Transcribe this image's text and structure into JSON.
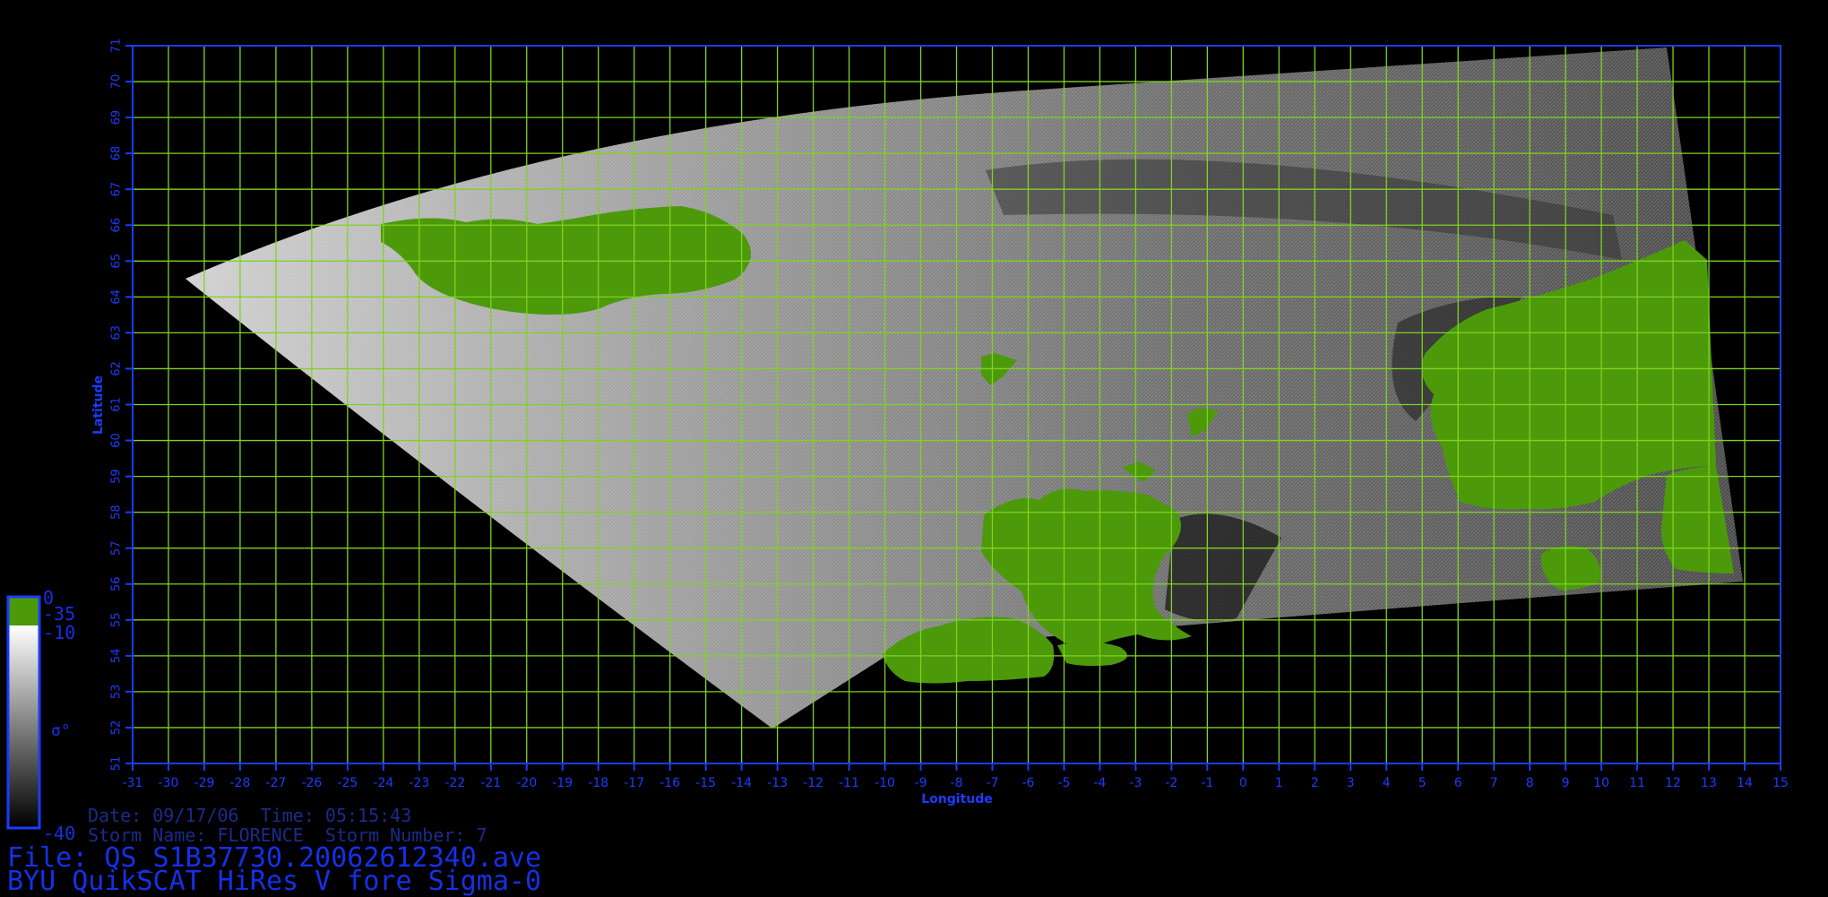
{
  "axes": {
    "x_label": "Longitude",
    "y_label": "Latitude",
    "x_ticks": [
      -31,
      -30,
      -29,
      -28,
      -27,
      -26,
      -25,
      -24,
      -23,
      -22,
      -21,
      -20,
      -19,
      -18,
      -17,
      -16,
      -15,
      -14,
      -13,
      -12,
      -11,
      -10,
      -9,
      -8,
      -7,
      -6,
      -5,
      -4,
      -3,
      -2,
      -1,
      0,
      1,
      2,
      3,
      4,
      5,
      6,
      7,
      8,
      9,
      10,
      11,
      12,
      13,
      14,
      15
    ],
    "y_ticks": [
      51,
      52,
      53,
      54,
      55,
      56,
      57,
      58,
      59,
      60,
      61,
      62,
      63,
      64,
      65,
      66,
      67,
      68,
      69,
      70,
      71
    ],
    "xlim": [
      -31,
      15
    ],
    "ylim": [
      51,
      71
    ],
    "grid": true,
    "grid_color": "#7ed321",
    "frame_color": "#1a3cff",
    "tick_color": "#1a3cff"
  },
  "colorbar": {
    "label": "σ°",
    "land_top": "0",
    "land_bottom": "-35",
    "scale_top": "-10",
    "scale_bottom": "-40",
    "land_color": "#4c9a0a",
    "high_color": "#ffffff",
    "low_color": "#000000"
  },
  "info": {
    "date_line": "Date: 09/17/06  Time: 05:15:43",
    "storm_line": "Storm Name: FLORENCE  Storm Number: 7",
    "file_line": "File: QS_S1B37730.20062612340.ave",
    "product_line": "BYU QuikSCAT HiRes V fore Sigma-0"
  },
  "colors": {
    "background": "#000000",
    "land": "#4c9a0a",
    "swath_light": "#c8c8c8",
    "swath_dark": "#3a3a3a"
  }
}
